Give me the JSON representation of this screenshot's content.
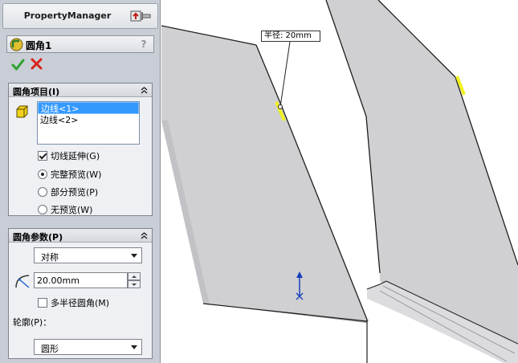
{
  "panel": {
    "title": "PropertyManager",
    "feature_title": "圆角1",
    "help": "?",
    "items_group": {
      "title": "圆角项目(I)",
      "edges": [
        "边线<1>",
        "边线<2>"
      ],
      "tangent_label": "切线延伸(G)",
      "tangent_checked": true,
      "preview_options": [
        {
          "label": "完整预览(W)",
          "checked": true
        },
        {
          "label": "部分预览(P)",
          "checked": false
        },
        {
          "label": "无预览(W)",
          "checked": false
        }
      ]
    },
    "params_group": {
      "title": "圆角参数(P)",
      "method_value": "对称",
      "radius_value": "20.00mm",
      "multi_radius_label": "多半径圆角(M)",
      "multi_radius_checked": false,
      "profile_label": "轮廓(P)：",
      "profile_value": "圆形"
    }
  },
  "viewport": {
    "callout_text": "半径: 20mm",
    "colors": {
      "face": "#cfcfd2",
      "edge": "#1e1e1e",
      "highlight": "#f0f020",
      "triad": "#1a3fb8"
    }
  }
}
